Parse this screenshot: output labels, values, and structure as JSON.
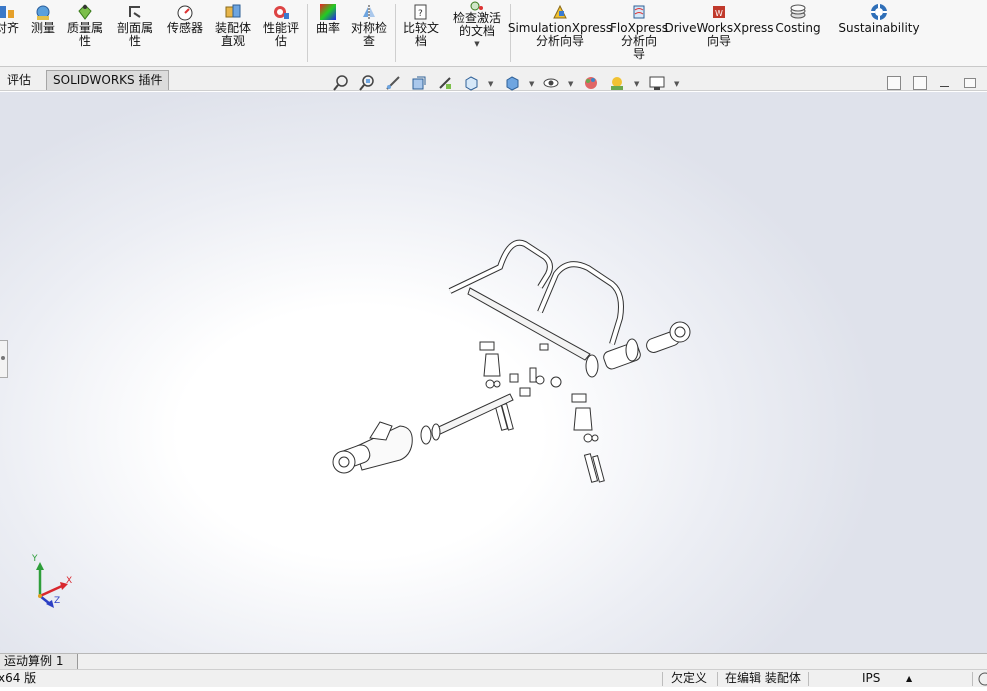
{
  "ribbon": {
    "buttons": [
      {
        "label": "对齐",
        "icon": "align-icon"
      },
      {
        "label": "测量",
        "icon": "measure-icon"
      },
      {
        "label": "质量属\n性",
        "icon": "mass-properties-icon"
      },
      {
        "label": "剖面属\n性",
        "icon": "section-properties-icon"
      },
      {
        "label": "传感器",
        "icon": "sensor-icon"
      },
      {
        "label": "装配体\n直观",
        "icon": "assembly-visualization-icon"
      },
      {
        "label": "性能评\n估",
        "icon": "performance-evaluation-icon"
      },
      {
        "label": "曲率",
        "icon": "curvature-icon"
      },
      {
        "label": "对称检\n查",
        "icon": "symmetry-check-icon"
      },
      {
        "label": "比较文\n档",
        "icon": "compare-documents-icon"
      },
      {
        "label": "检查激活\n的文档",
        "icon": "check-active-document-icon"
      },
      {
        "label": "SimulationXpress\n分析向导",
        "icon": "simulationxpress-icon"
      },
      {
        "label": "FloXpress\n分析向\n导",
        "icon": "floxpress-icon"
      },
      {
        "label": "DriveWorksXpress\n向导",
        "icon": "driveworksxpress-icon"
      },
      {
        "label": "Costing",
        "icon": "costing-icon"
      },
      {
        "label": "Sustainability",
        "icon": "sustainability-icon"
      }
    ]
  },
  "tabs": [
    {
      "label": "评估",
      "active": false
    },
    {
      "label": "SOLIDWORKS 插件",
      "active": true
    }
  ],
  "view_toolbar": [
    "zoom-to-fit-icon",
    "zoom-to-area-icon",
    "previous-view-icon",
    "section-view-icon",
    "dynamic-annotation-views-icon",
    "view-orientation-icon",
    "display-style-icon",
    "hide-show-items-icon",
    "edit-appearance-icon",
    "apply-scene-icon",
    "view-settings-icon"
  ],
  "triad": {
    "x_label": "X",
    "y_label": "Y",
    "z_label": "Z"
  },
  "bottom_tab": "运动算例 1",
  "status": {
    "version": "x64 版",
    "definition": "欠定义",
    "editing": "在编辑 装配体",
    "units": "IPS"
  },
  "colors": {
    "ribbon_bg": "#f7f7f7",
    "active_tab_bg": "#dcdcdc",
    "status_bg": "#f0f0f0",
    "triad_x": "#d9272e",
    "triad_y": "#2e9e3a",
    "triad_z": "#2b3fc4"
  }
}
